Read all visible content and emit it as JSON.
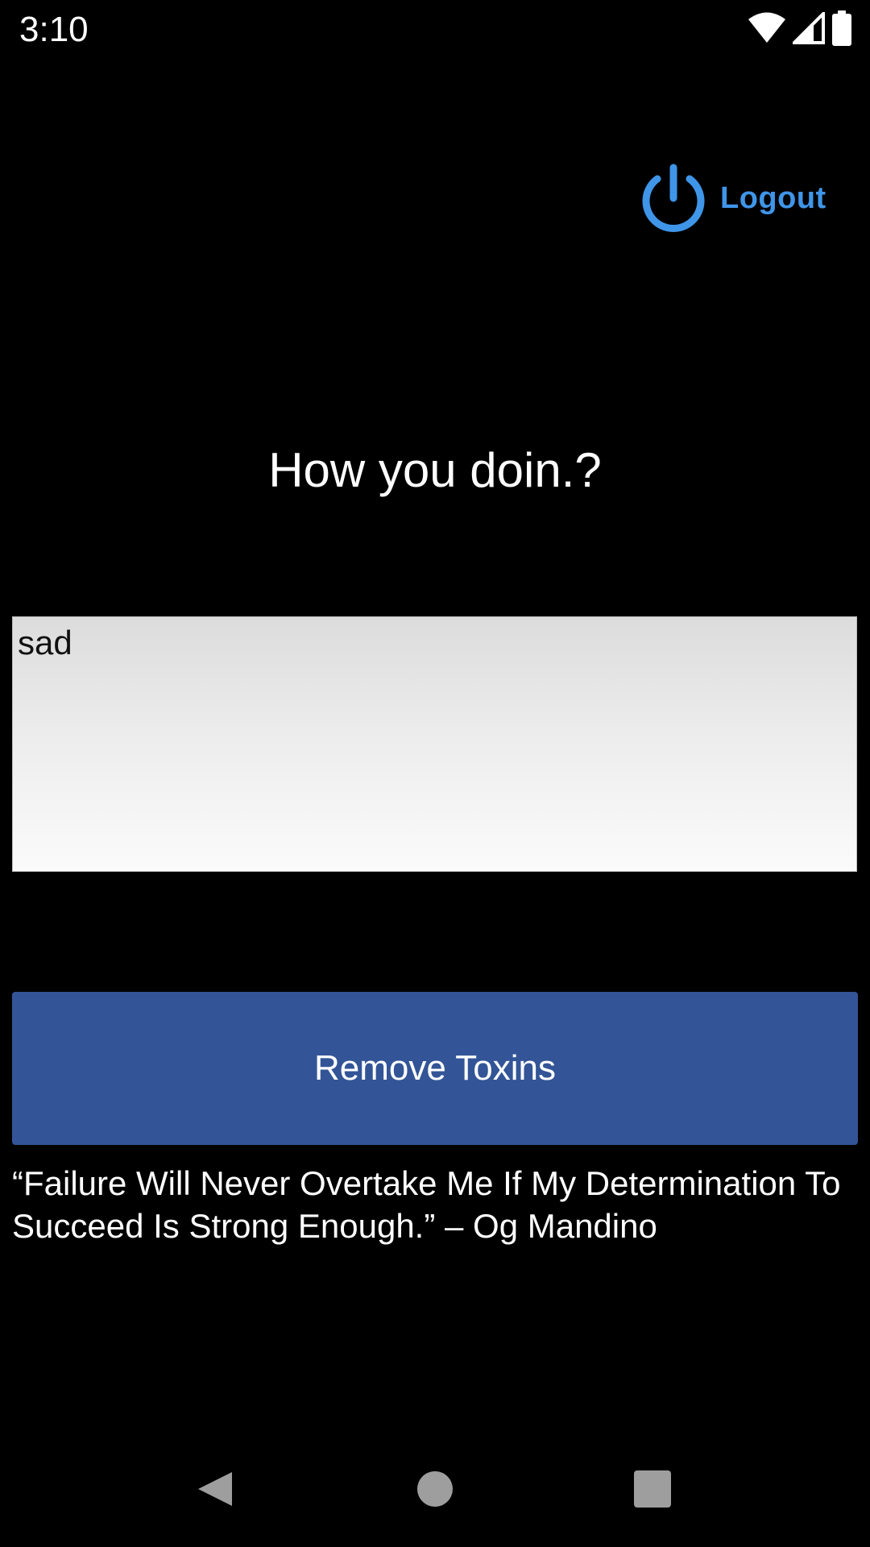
{
  "status_bar": {
    "time": "3:10",
    "icons": [
      "wifi-icon",
      "cellular-signal-icon",
      "battery-icon"
    ]
  },
  "header": {
    "logout_label": "Logout",
    "logout_icon": "power-icon",
    "accent_color": "#3f95e8"
  },
  "main": {
    "greeting": "How you doin.?",
    "mood_input_value": "sad",
    "remove_button_label": "Remove Toxins",
    "button_color": "#335597",
    "quote": "“Failure Will Never Overtake Me If My Determination To Succeed Is Strong Enough.” – Og Mandino"
  },
  "nav_bar": {
    "buttons": [
      "back-icon",
      "home-icon",
      "recents-icon"
    ]
  }
}
